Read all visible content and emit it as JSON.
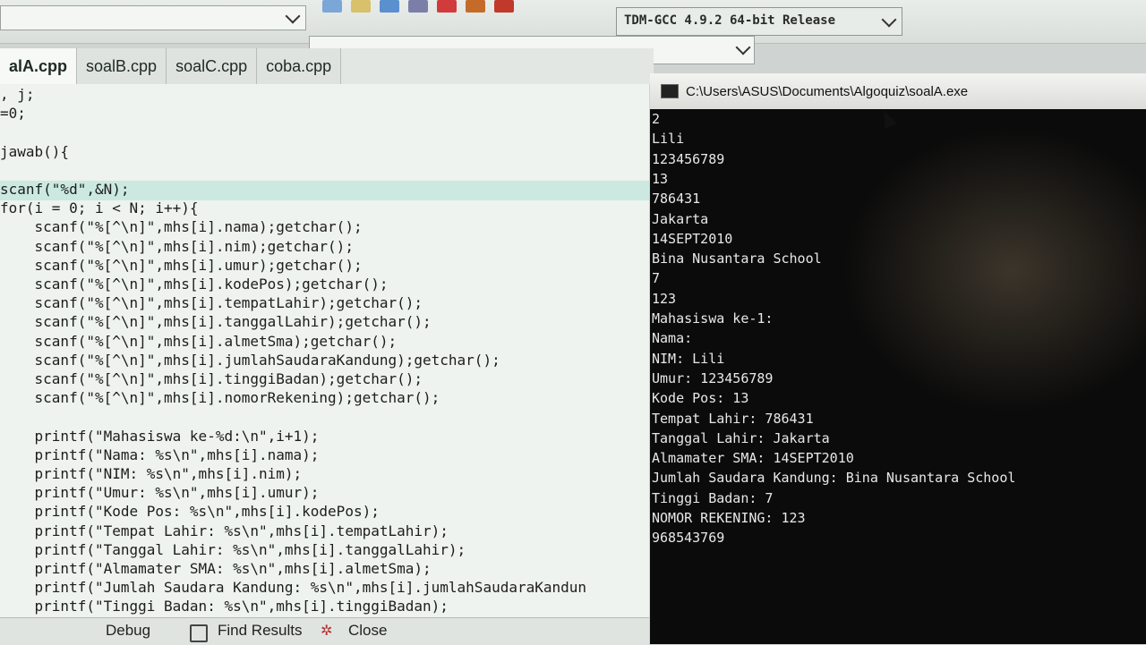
{
  "toolbar": {
    "compiler": "TDM-GCC 4.9.2 64-bit Release",
    "icon_colors": [
      "#7aa7d8",
      "#d9c06a",
      "#5a8fd0",
      "#7b7fa8",
      "#d23b3b",
      "#c56b2a",
      "#c0392b"
    ]
  },
  "tabs": [
    {
      "label": "alA.cpp",
      "active": true
    },
    {
      "label": "soalB.cpp",
      "active": false
    },
    {
      "label": "soalC.cpp",
      "active": false
    },
    {
      "label": "coba.cpp",
      "active": false
    }
  ],
  "code_lines": [
    ", j;",
    "=0;",
    "",
    "jawab(){",
    "",
    "scanf(\"%d\",&N);",
    "for(i = 0; i < N; i++){",
    "    scanf(\"%[^\\n]\",mhs[i].nama);getchar();",
    "    scanf(\"%[^\\n]\",mhs[i].nim);getchar();",
    "    scanf(\"%[^\\n]\",mhs[i].umur);getchar();",
    "    scanf(\"%[^\\n]\",mhs[i].kodePos);getchar();",
    "    scanf(\"%[^\\n]\",mhs[i].tempatLahir);getchar();",
    "    scanf(\"%[^\\n]\",mhs[i].tanggalLahir);getchar();",
    "    scanf(\"%[^\\n]\",mhs[i].almetSma);getchar();",
    "    scanf(\"%[^\\n]\",mhs[i].jumlahSaudaraKandung);getchar();",
    "    scanf(\"%[^\\n]\",mhs[i].tinggiBadan);getchar();",
    "    scanf(\"%[^\\n]\",mhs[i].nomorRekening);getchar();",
    "",
    "    printf(\"Mahasiswa ke-%d:\\n\",i+1);",
    "    printf(\"Nama: %s\\n\",mhs[i].nama);",
    "    printf(\"NIM: %s\\n\",mhs[i].nim);",
    "    printf(\"Umur: %s\\n\",mhs[i].umur);",
    "    printf(\"Kode Pos: %s\\n\",mhs[i].kodePos);",
    "    printf(\"Tempat Lahir: %s\\n\",mhs[i].tempatLahir);",
    "    printf(\"Tanggal Lahir: %s\\n\",mhs[i].tanggalLahir);",
    "    printf(\"Almamater SMA: %s\\n\",mhs[i].almetSma);",
    "    printf(\"Jumlah Saudara Kandung: %s\\n\",mhs[i].jumlahSaudaraKandun",
    "    printf(\"Tinggi Badan: %s\\n\",mhs[i].tinggiBadan);"
  ],
  "bottom_bar": {
    "debug": "Debug",
    "find_results": "Find Results",
    "close": "Close"
  },
  "console": {
    "title": "C:\\Users\\ASUS\\Documents\\Algoquiz\\soalA.exe",
    "lines": [
      "2",
      "Lili",
      "123456789",
      "13",
      "786431",
      "Jakarta",
      "14SEPT2010",
      "Bina Nusantara School",
      "7",
      "123",
      "Mahasiswa ke-1:",
      "Nama:",
      "NIM: Lili",
      "Umur: 123456789",
      "Kode Pos: 13",
      "Tempat Lahir: 786431",
      "Tanggal Lahir: Jakarta",
      "Almamater SMA: 14SEPT2010",
      "Jumlah Saudara Kandung: Bina Nusantara School",
      "Tinggi Badan: 7",
      "NOMOR REKENING: 123",
      "968543769"
    ]
  }
}
